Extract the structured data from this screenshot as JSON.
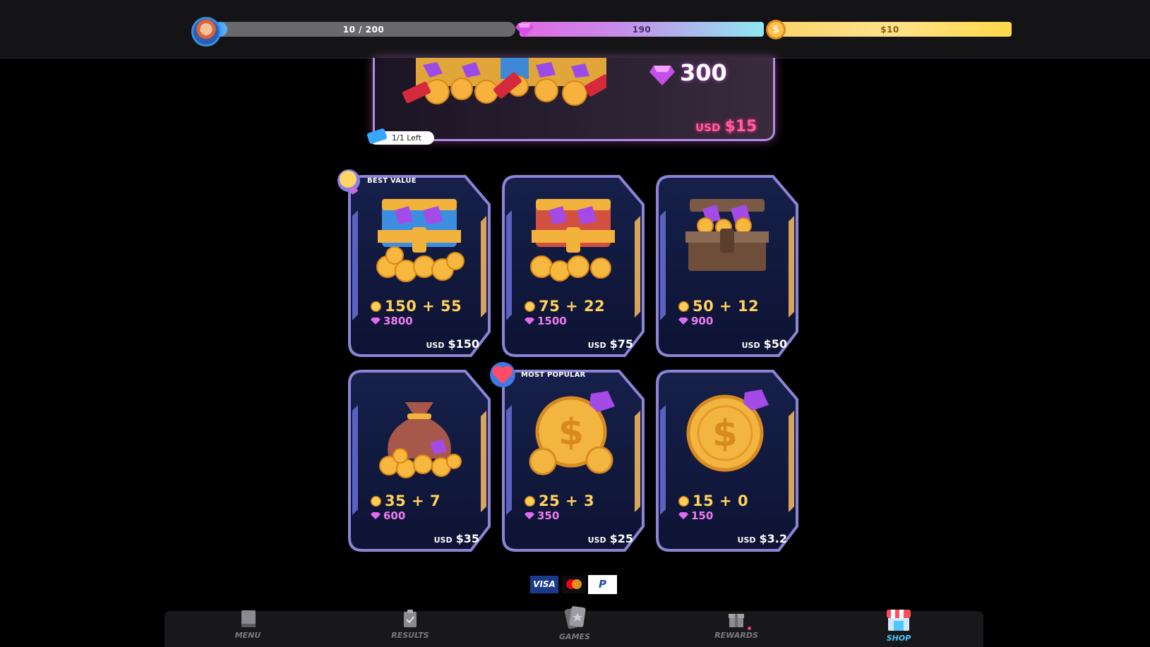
{
  "topbar": {
    "xp_text": "10 / 200",
    "xp_progress": 0.05,
    "gems_text": "190",
    "cash_text": "$10"
  },
  "featured": {
    "gem_amount": "300",
    "currency": "USD",
    "price": "$15",
    "left_tag": "1/1 Left"
  },
  "badges": {
    "best_value": "BEST VALUE",
    "most_popular": "MOST POPULAR"
  },
  "packs": [
    {
      "coins": "150 + 55",
      "gems": "3800",
      "currency": "USD",
      "price": "$150",
      "art": "blue-chest-icon"
    },
    {
      "coins": "75 + 22",
      "gems": "1500",
      "currency": "USD",
      "price": "$75",
      "art": "red-chest-icon"
    },
    {
      "coins": "50 + 12",
      "gems": "900",
      "currency": "USD",
      "price": "$50",
      "art": "wood-chest-icon"
    },
    {
      "coins": "35 + 7",
      "gems": "600",
      "currency": "USD",
      "price": "$35",
      "art": "coin-bag-icon"
    },
    {
      "coins": "25 + 3",
      "gems": "350",
      "currency": "USD",
      "price": "$25",
      "art": "coin-stack-icon"
    },
    {
      "coins": "15 + 0",
      "gems": "150",
      "currency": "USD",
      "price": "$3.2",
      "art": "single-coin-icon"
    }
  ],
  "payments": {
    "visa": "VISA",
    "paypal": "P"
  },
  "nav": [
    {
      "label": "MENU",
      "icon": "book-icon"
    },
    {
      "label": "RESULTS",
      "icon": "clipboard-icon"
    },
    {
      "label": "GAMES",
      "icon": "cards-icon"
    },
    {
      "label": "REWARDS",
      "icon": "gift-icon"
    },
    {
      "label": "SHOP",
      "icon": "shop-icon"
    }
  ],
  "colors": {
    "accent_blue": "#4ec8ff",
    "coin_gold": "#ffd25a",
    "gem_pink": "#f07cf2",
    "price_pink": "#ff5fa3",
    "card_bg": "#111b3d",
    "card_border": "#7a74c9"
  }
}
